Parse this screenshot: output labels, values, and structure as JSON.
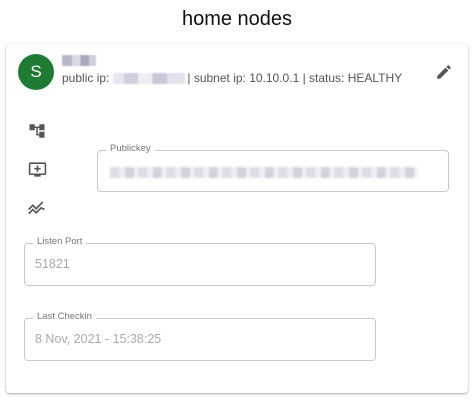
{
  "page": {
    "title": "home nodes"
  },
  "node": {
    "avatar_letter": "S",
    "public_ip_label": "public ip:",
    "subnet_status_text": "| subnet ip: 10.10.0.1 | status: HEALTHY"
  },
  "icons": {
    "edit": "pencil-icon",
    "side": [
      "network-tree-icon",
      "add-monitor-icon",
      "trending-chart-icon"
    ]
  },
  "fields": {
    "publickey": {
      "label": "Publickey"
    },
    "listen_port": {
      "label": "Listen Port",
      "value": "51821"
    },
    "last_checkin": {
      "label": "Last Checkin",
      "value": "8 Nov, 2021 - 15:38:25"
    }
  },
  "colors": {
    "avatar_bg": "#1e7b33",
    "icon_gray": "#555555"
  }
}
